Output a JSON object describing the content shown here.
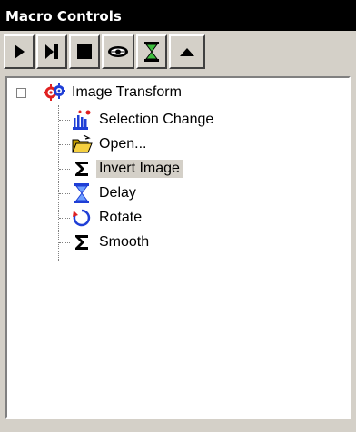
{
  "window": {
    "title": "Macro Controls"
  },
  "toolbar": {
    "buttons": [
      {
        "name": "play-button",
        "icon": "play-icon"
      },
      {
        "name": "step-button",
        "icon": "step-icon"
      },
      {
        "name": "stop-button",
        "icon": "stop-icon"
      },
      {
        "name": "eye-button",
        "icon": "eye-icon"
      },
      {
        "name": "delay-button",
        "icon": "hourglass-icon"
      },
      {
        "name": "collapse-button",
        "icon": "triangle-up-icon"
      }
    ]
  },
  "tree": {
    "root": {
      "label": "Image Transform",
      "icon": "gears-icon",
      "expander": "−"
    },
    "items": [
      {
        "label": "Selection Change",
        "icon": "hand-pointer-icon"
      },
      {
        "label": "Open...",
        "icon": "folder-open-icon"
      },
      {
        "label": "Invert Image",
        "icon": "sigma-icon",
        "selected": true
      },
      {
        "label": "Delay",
        "icon": "hourglass-icon"
      },
      {
        "label": "Rotate",
        "icon": "rotate-icon"
      },
      {
        "label": "Smooth",
        "icon": "sigma-icon"
      }
    ]
  },
  "colors": {
    "accent": "#1f3fd6",
    "selection": "#d4d0c8",
    "hourglass": "#2aa02a",
    "folder": "#f0c020"
  }
}
